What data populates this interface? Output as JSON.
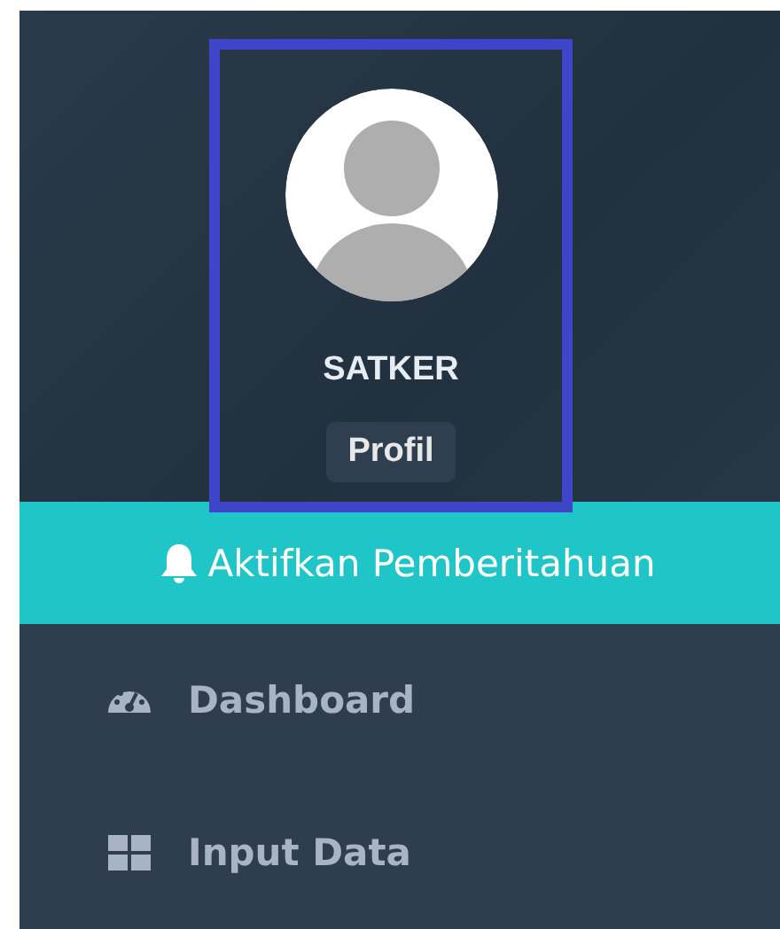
{
  "profile": {
    "name": "SATKER",
    "tooltip": "Profil"
  },
  "notification_button": {
    "label": "Aktifkan Pemberitahuan"
  },
  "menu": [
    {
      "label": "Dashboard",
      "kind": "gauge"
    },
    {
      "label": "Input Data",
      "kind": "grid"
    }
  ]
}
